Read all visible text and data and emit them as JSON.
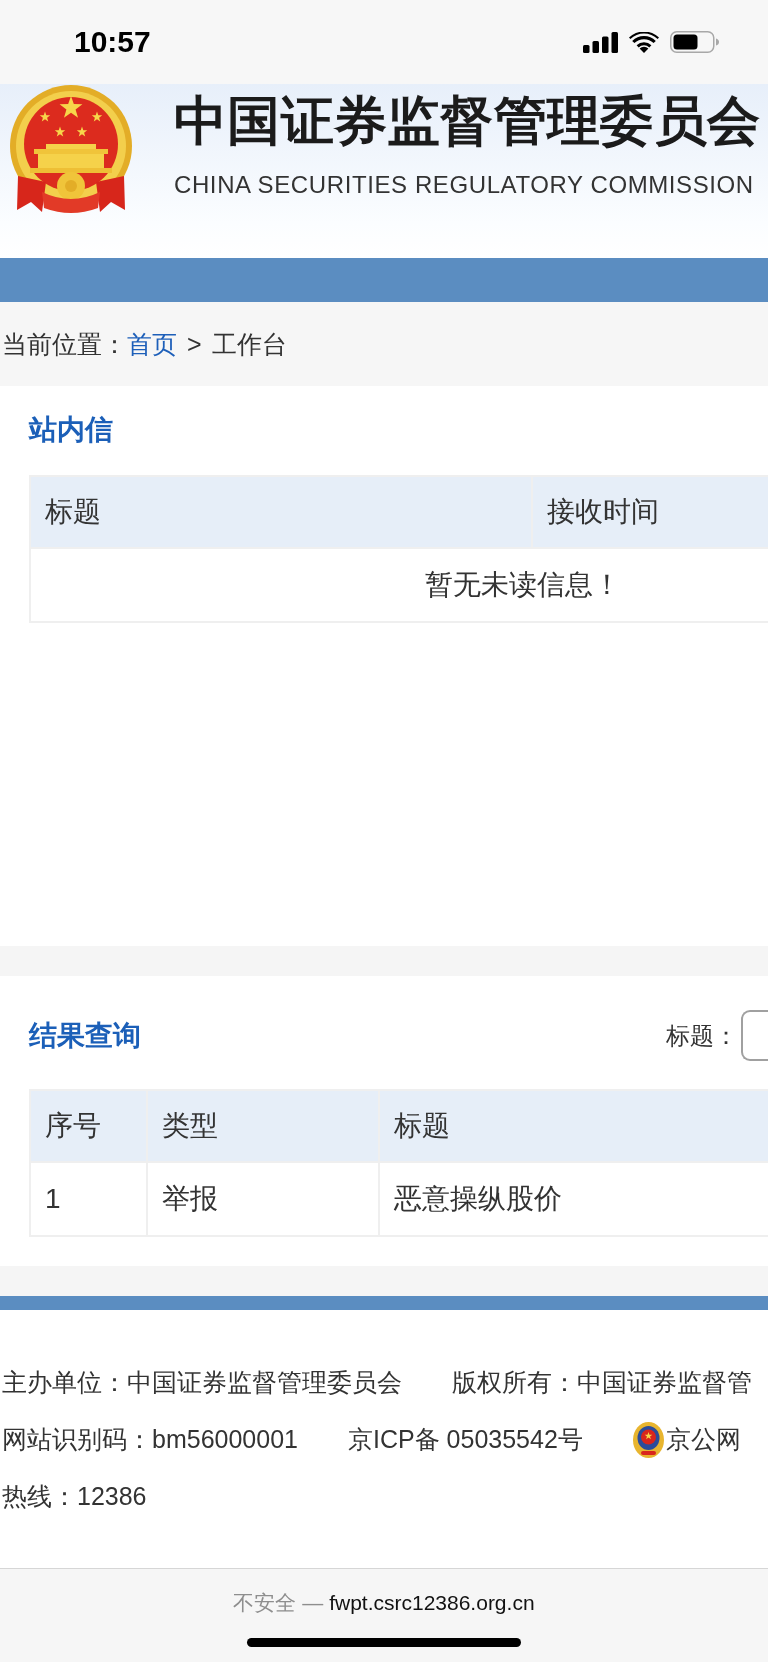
{
  "status_bar": {
    "time": "10:57"
  },
  "header": {
    "title": "中国证券监督管理委员会",
    "subtitle": "CHINA SECURITIES REGULATORY COMMISSION"
  },
  "breadcrumb": {
    "label": "当前位置：",
    "separator": ">",
    "items": [
      {
        "text": "首页",
        "kind": "link"
      },
      {
        "text": "工作台",
        "kind": "current"
      }
    ]
  },
  "inbox": {
    "title": "站内信",
    "columns": [
      "标题",
      "接收时间"
    ],
    "empty_message": "暂无未读信息！"
  },
  "results": {
    "title": "结果查询",
    "filter": {
      "label": "标题："
    },
    "columns": [
      "序号",
      "类型",
      "标题"
    ],
    "rows": [
      [
        "1",
        "举报",
        "恶意操纵股价"
      ]
    ]
  },
  "footer": {
    "lines": [
      [
        {
          "kind": "text",
          "text": "主办单位：中国证券监督管理委员会"
        },
        {
          "kind": "text",
          "text": "版权所有：中国证券监督管"
        }
      ],
      [
        {
          "kind": "text",
          "text": "网站识别码：bm56000001"
        },
        {
          "kind": "text",
          "text": "京ICP备 05035542号"
        },
        {
          "kind": "emblem",
          "text": "京公网"
        }
      ],
      [
        {
          "kind": "text",
          "text": "热线：12386"
        }
      ]
    ]
  },
  "browser": {
    "security": "不安全",
    "separator": "—",
    "url": "fwpt.csrc12386.org.cn"
  }
}
